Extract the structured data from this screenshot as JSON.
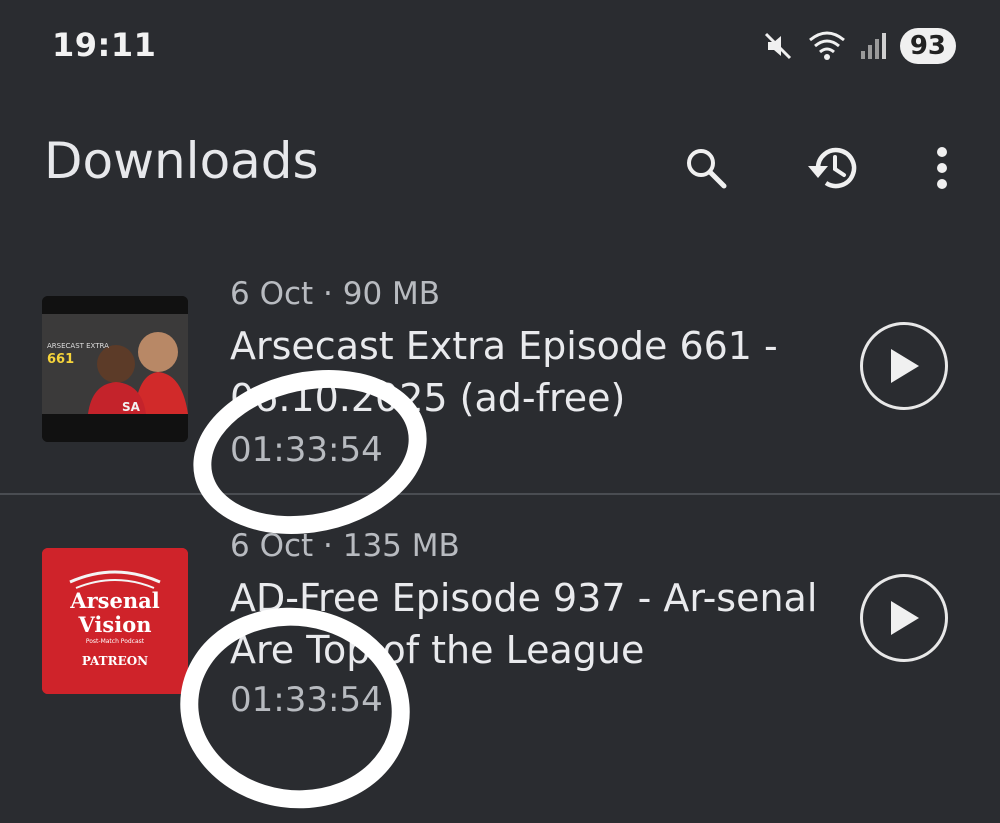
{
  "status_bar": {
    "time": "19:11",
    "battery": "93",
    "icons": [
      "mute-icon",
      "wifi-icon",
      "signal-icon"
    ]
  },
  "app_bar": {
    "title": "Downloads",
    "actions": [
      "search-icon",
      "history-icon",
      "more-vert-icon"
    ]
  },
  "downloads": [
    {
      "meta": "6 Oct · 90 MB",
      "title": "Arsecast Extra Episode 661 - 06.10.2025 (ad-free)",
      "duration": "01:33:54",
      "thumbnail": {
        "label_top": "ARSECAST EXTRA",
        "label_num": "661",
        "shirt_text": "SA"
      }
    },
    {
      "meta": "6 Oct · 135 MB",
      "title": "AD-Free Episode 937 - Ar-senal Are Top of the League",
      "duration": "01:33:54",
      "thumbnail": {
        "line1": "Arsenal",
        "line2": "Vision",
        "sub": "Post-Match Podcast",
        "badge": "PATREON"
      }
    }
  ],
  "colors": {
    "background": "#2a2c30",
    "annotation": "#ffffff",
    "thumb2_red": "#d0242b"
  }
}
